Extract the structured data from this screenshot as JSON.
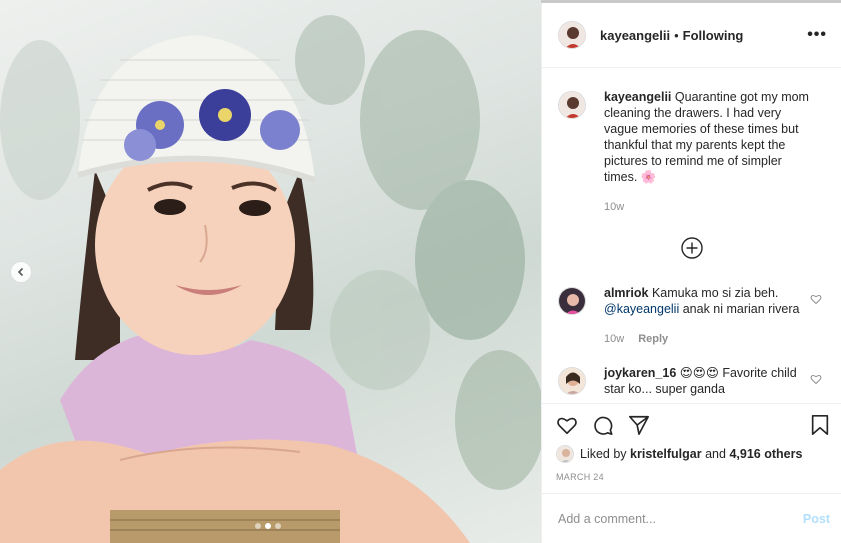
{
  "post": {
    "username": "kayeangelii",
    "separator": "•",
    "follow_status": "Following",
    "more_icon": "more-horizontal-icon",
    "caption": {
      "username": "kayeangelii",
      "text": "Quarantine got my mom cleaning the drawers. I had very vague memories of these times but thankful that my parents kept the pictures to remind me of simpler times.",
      "emoji": "🌸",
      "time": "10w"
    },
    "load_more_icon": "plus-circle-icon",
    "comments": [
      {
        "username": "almriok",
        "text_before": "Kamuka mo si zia beh.",
        "mention": "@kayeangelii",
        "text_after": "anak ni marian rivera",
        "time": "10w",
        "reply_label": "Reply"
      },
      {
        "username": "joykaren_16",
        "text": "😍😍😍 Favorite child star ko... super ganda"
      }
    ],
    "likes": {
      "prefix": "Liked by",
      "user": "kristelfulgar",
      "conjunction": "and",
      "others": "4,916 others"
    },
    "date": "MARCH 24",
    "add_comment": {
      "placeholder": "Add a comment...",
      "post_label": "Post"
    }
  },
  "carousel": {
    "prev_icon": "chevron-left-icon",
    "slide_count": 3,
    "active_slide": 2
  },
  "colors": {
    "text": "#262626",
    "secondary": "#8e8e8e",
    "link": "#00376b",
    "post_disabled": "#b2dffc",
    "border": "#efefef"
  }
}
